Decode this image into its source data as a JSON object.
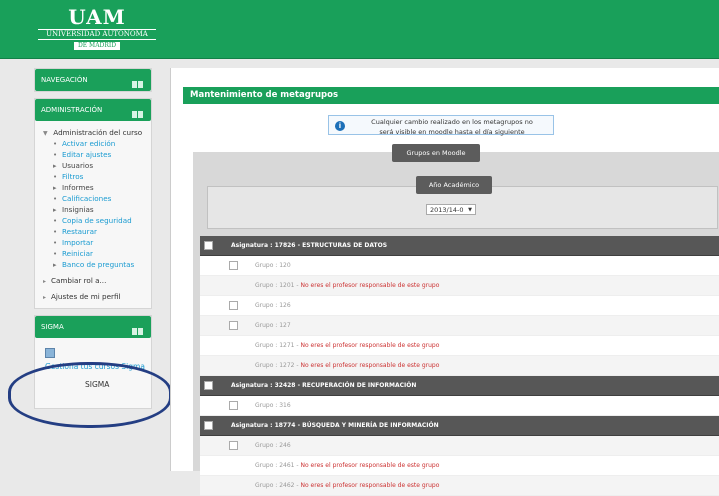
{
  "brand": {
    "logo_mark": "UAM",
    "logo_text": "UNIVERSIDAD AUTONOMA",
    "logo_sub": "DE MADRID"
  },
  "sidebar": {
    "nav_title": "NAVEGACIÓN",
    "admin_title": "ADMINISTRACIÓN",
    "admin_course_title": "Administración del curso",
    "admin_items": [
      {
        "label": "Activar edición",
        "icon": "pencil-icon",
        "type": "link"
      },
      {
        "label": "Editar ajustes",
        "icon": "gear-icon",
        "type": "link"
      },
      {
        "label": "Usuarios",
        "icon": "triangle-right-icon",
        "type": "group"
      },
      {
        "label": "Filtros",
        "icon": "filter-icon",
        "type": "link"
      },
      {
        "label": "Informes",
        "icon": "triangle-right-icon",
        "type": "group"
      },
      {
        "label": "Calificaciones",
        "icon": "grades-icon",
        "type": "link"
      },
      {
        "label": "Insignias",
        "icon": "triangle-right-icon",
        "type": "group"
      },
      {
        "label": "Copia de seguridad",
        "icon": "backup-icon",
        "type": "link"
      },
      {
        "label": "Restaurar",
        "icon": "restore-icon",
        "type": "link"
      },
      {
        "label": "Importar",
        "icon": "import-icon",
        "type": "link"
      },
      {
        "label": "Reiniciar",
        "icon": "reset-icon",
        "type": "link"
      },
      {
        "label": "Banco de preguntas",
        "icon": "triangle-right-icon",
        "type": "link"
      }
    ],
    "admin_extra": [
      {
        "label": "Cambiar rol a...",
        "icon": "triangle-right-icon"
      },
      {
        "label": "Ajustes de mi perfil",
        "icon": "triangle-right-icon"
      }
    ],
    "sigma_title": "SIGMA",
    "sigma_link": "Gestiona tus cursos Sigma",
    "sigma_name": "SIGMA"
  },
  "main": {
    "title": "Mantenimiento de metagrupos",
    "notice_line1": "Cualquier cambio realizado en los metagrupos no",
    "notice_line2": "será visible en moodle hasta el día siguiente",
    "groups_panel_title": "Grupos en Moodle",
    "year_title": "Año Académico",
    "year_value": "2013/14-0",
    "table_rows": [
      {
        "kind": "header",
        "text": "Asignatura : 17826 - ESTRUCTURAS DE DATOS"
      },
      {
        "kind": "row",
        "text": "Grupo : 120"
      },
      {
        "kind": "row",
        "text": "Grupo : 1201 - ",
        "warn": "No eres el profesor responsable de este grupo"
      },
      {
        "kind": "row",
        "text": "Grupo : 126"
      },
      {
        "kind": "row",
        "text": "Grupo : 127"
      },
      {
        "kind": "row",
        "text": "Grupo : 1271 - ",
        "warn": "No eres el profesor responsable de este grupo"
      },
      {
        "kind": "row",
        "text": "Grupo : 1272 - ",
        "warn": "No eres el profesor responsable de este grupo"
      },
      {
        "kind": "header",
        "text": "Asignatura : 32428 - RECUPERACIÓN DE INFORMACIÓN"
      },
      {
        "kind": "row",
        "text": "Grupo : 316"
      },
      {
        "kind": "header",
        "text": "Asignatura : 18774 - BÚSQUEDA Y MINERÍA DE INFORMACIÓN"
      },
      {
        "kind": "row",
        "text": "Grupo : 246"
      },
      {
        "kind": "row",
        "text": "Grupo : 2461 - ",
        "warn": "No eres el profesor responsable de este grupo"
      },
      {
        "kind": "row",
        "text": "Grupo : 2462 - ",
        "warn": "No eres el profesor responsable de este grupo"
      }
    ]
  },
  "colors": {
    "brand_green": "#19a05a",
    "header_dark": "#575757",
    "warn_red": "#cc3333",
    "link_blue": "#1a9bd1",
    "annotation_blue": "#243e83"
  }
}
